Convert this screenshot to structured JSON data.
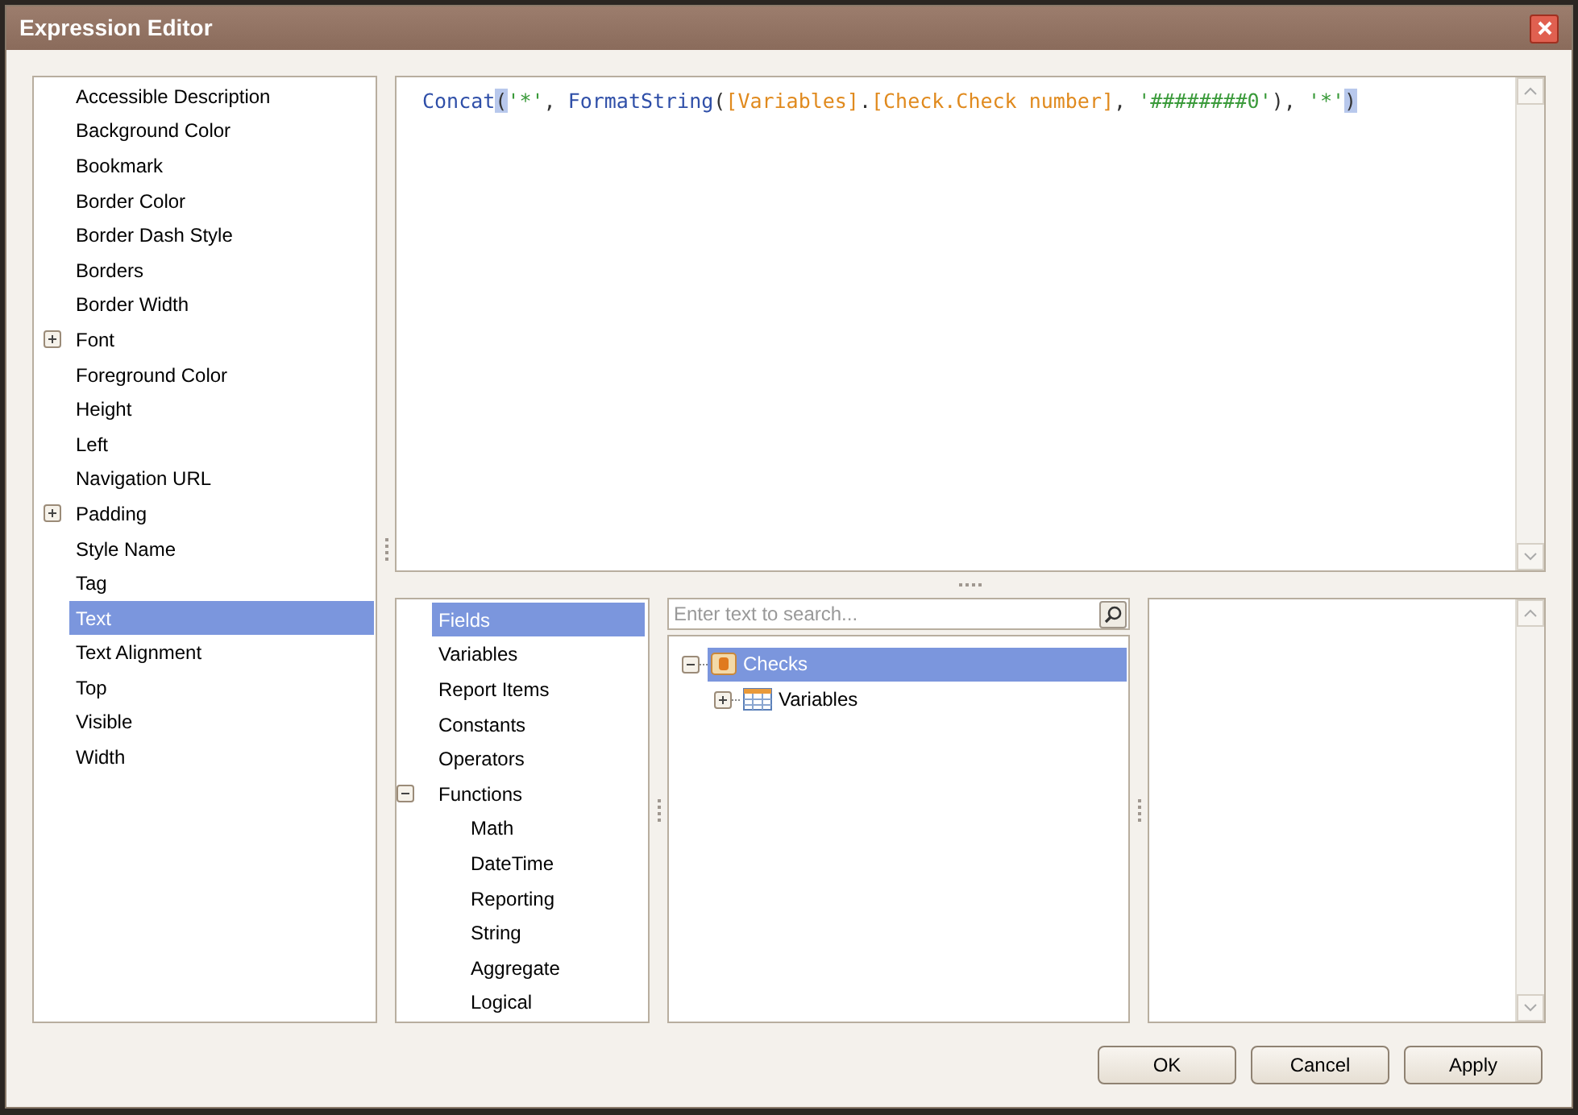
{
  "window": {
    "title": "Expression Editor"
  },
  "properties": [
    {
      "label": "Accessible Description",
      "selected": false
    },
    {
      "label": "Background Color",
      "selected": false
    },
    {
      "label": "Bookmark",
      "selected": false
    },
    {
      "label": "Border Color",
      "selected": false
    },
    {
      "label": "Border Dash Style",
      "selected": false
    },
    {
      "label": "Borders",
      "selected": false
    },
    {
      "label": "Border Width",
      "selected": false
    },
    {
      "label": "Font",
      "selected": false,
      "expanded": false
    },
    {
      "label": "Foreground Color",
      "selected": false
    },
    {
      "label": "Height",
      "selected": false
    },
    {
      "label": "Left",
      "selected": false
    },
    {
      "label": "Navigation URL",
      "selected": false
    },
    {
      "label": "Padding",
      "selected": false,
      "expanded": false
    },
    {
      "label": "Style Name",
      "selected": false
    },
    {
      "label": "Tag",
      "selected": false
    },
    {
      "label": "Text",
      "selected": true
    },
    {
      "label": "Text Alignment",
      "selected": false
    },
    {
      "label": "Top",
      "selected": false
    },
    {
      "label": "Visible",
      "selected": false
    },
    {
      "label": "Width",
      "selected": false
    }
  ],
  "expression": [
    {
      "kind": "function",
      "text": "Concat"
    },
    {
      "kind": "punct",
      "text": "(",
      "highlight": true
    },
    {
      "kind": "string",
      "text": "'*'"
    },
    {
      "kind": "punct",
      "text": ", "
    },
    {
      "kind": "function",
      "text": "FormatString"
    },
    {
      "kind": "punct",
      "text": "("
    },
    {
      "kind": "field",
      "text": "[Variables]"
    },
    {
      "kind": "punct",
      "text": "."
    },
    {
      "kind": "field",
      "text": "[Check.Check number]"
    },
    {
      "kind": "punct",
      "text": ", "
    },
    {
      "kind": "string",
      "text": "'########0'"
    },
    {
      "kind": "punct",
      "text": "), "
    },
    {
      "kind": "string",
      "text": "'*'"
    },
    {
      "kind": "punct",
      "text": ")",
      "highlight": true
    }
  ],
  "categories": [
    {
      "label": "Fields",
      "selected": true
    },
    {
      "label": "Variables",
      "selected": false
    },
    {
      "label": "Report Items",
      "selected": false
    },
    {
      "label": "Constants",
      "selected": false
    },
    {
      "label": "Operators",
      "selected": false
    },
    {
      "label": "Functions",
      "selected": false,
      "expanded": true,
      "children": [
        {
          "label": "Math",
          "selected": false
        },
        {
          "label": "DateTime",
          "selected": false
        },
        {
          "label": "Reporting",
          "selected": false
        },
        {
          "label": "String",
          "selected": false
        },
        {
          "label": "Aggregate",
          "selected": false
        },
        {
          "label": "Logical",
          "selected": false
        }
      ]
    }
  ],
  "search": {
    "placeholder": "Enter text to search..."
  },
  "tree": [
    {
      "label": "Checks",
      "kind": "datasource",
      "selected": true,
      "expanded": true,
      "children": [
        {
          "label": "Variables",
          "kind": "table",
          "selected": false,
          "expanded": false
        }
      ]
    }
  ],
  "buttons": [
    "OK",
    "Cancel",
    "Apply"
  ]
}
